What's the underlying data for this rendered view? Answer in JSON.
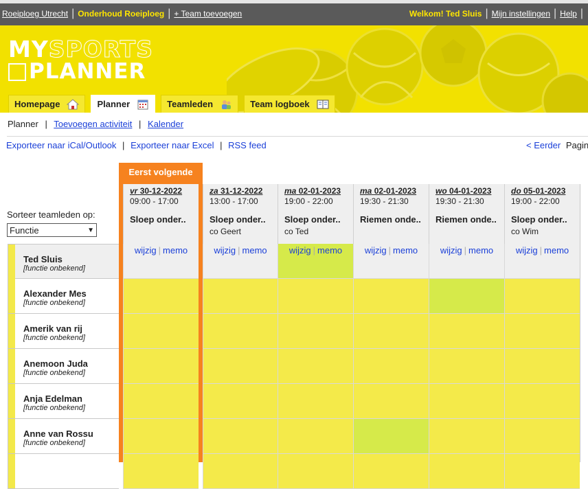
{
  "topbar": {
    "team": "Roeiploeg Utrecht",
    "maintenance": "Onderhoud Roeiploeg",
    "add_team": "+ Team toevoegen",
    "welcome": "Welkom! Ted Sluis",
    "settings": "Mijn instellingen",
    "help": "Help"
  },
  "logo": {
    "line1_a": "MY",
    "line1_b": "SPORTS",
    "line2": "PLANNER"
  },
  "tabs": [
    {
      "label": "Homepage",
      "icon": "house-icon"
    },
    {
      "label": "Planner",
      "icon": "calendar-icon"
    },
    {
      "label": "Teamleden",
      "icon": "people-icon"
    },
    {
      "label": "Team logboek",
      "icon": "book-icon"
    }
  ],
  "subnav": {
    "current": "Planner",
    "add_activity": "Toevoegen activiteit",
    "calendar": "Kalender"
  },
  "exports": {
    "ical": "Exporteer naar iCal/Outlook",
    "excel": "Exporteer naar Excel",
    "rss": "RSS feed"
  },
  "pager": {
    "earlier": "< Eerder",
    "page": "Pagina"
  },
  "sort": {
    "label": "Sorteer teamleden op:",
    "selected": "Functie"
  },
  "next_label": "Eerst volgende",
  "cell_links": {
    "edit": "wijzig",
    "memo": "memo"
  },
  "days": [
    {
      "dow": "vr",
      "date": "30-12-2022",
      "time": "09:00 - 17:00",
      "activity": "Sloep onder..",
      "co": ""
    },
    {
      "dow": "za",
      "date": "31-12-2022",
      "time": "13:00 - 17:00",
      "activity": "Sloep onder..",
      "co": "co Geert"
    },
    {
      "dow": "ma",
      "date": "02-01-2023",
      "time": "19:00 - 22:00",
      "activity": "Sloep onder..",
      "co": "co Ted"
    },
    {
      "dow": "ma",
      "date": "02-01-2023",
      "time": "19:30 - 21:30",
      "activity": "Riemen onde..",
      "co": ""
    },
    {
      "dow": "wo",
      "date": "04-01-2023",
      "time": "19:30 - 21:30",
      "activity": "Riemen onde..",
      "co": ""
    },
    {
      "dow": "do",
      "date": "05-01-2023",
      "time": "19:00 - 22:00",
      "activity": "Sloep onder..",
      "co": "co Wim"
    }
  ],
  "members": [
    {
      "name": "Ted Sluis",
      "function": "[functie onbekend]",
      "green": [
        2
      ]
    },
    {
      "name": "Alexander Mes",
      "function": "[functie onbekend]",
      "green": [
        4
      ]
    },
    {
      "name": "Amerik van rij",
      "function": "[functie onbekend]",
      "green": []
    },
    {
      "name": "Anemoon Juda",
      "function": "[functie onbekend]",
      "green": []
    },
    {
      "name": "Anja Edelman",
      "function": "[functie onbekend]",
      "green": []
    },
    {
      "name": "Anne van Rossu",
      "function": "[functie onbekend]",
      "green": [
        3
      ]
    },
    {
      "name": "",
      "function": "",
      "green": []
    }
  ]
}
